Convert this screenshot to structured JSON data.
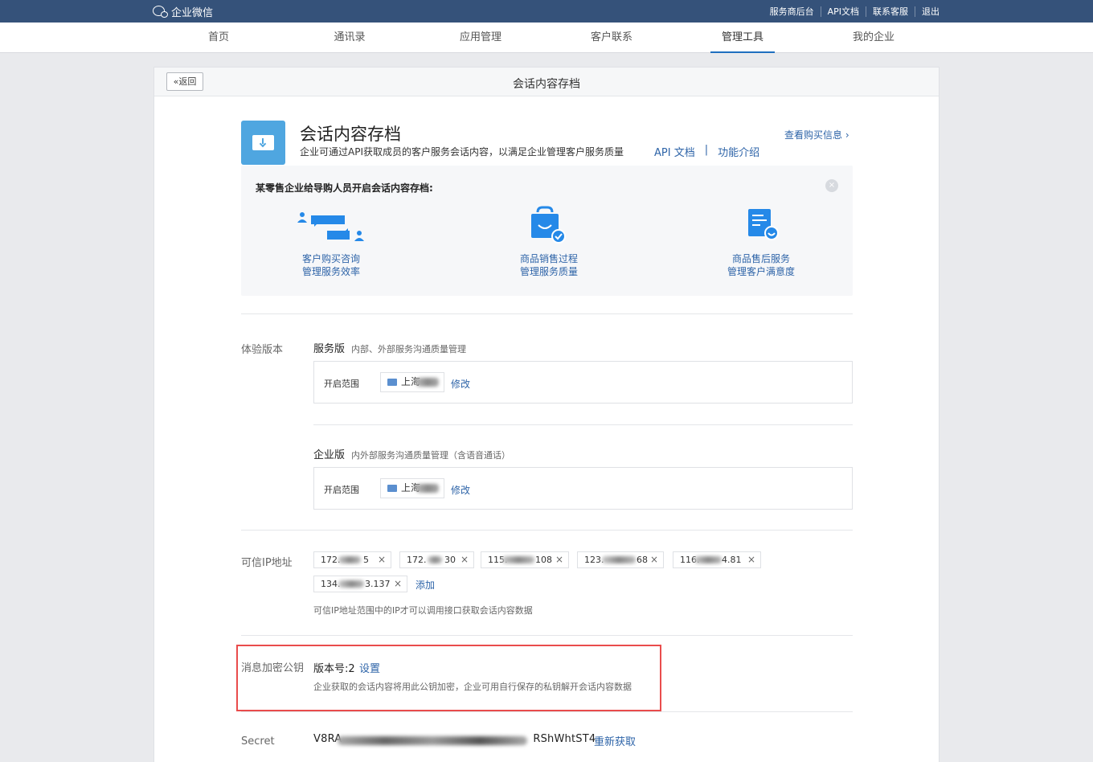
{
  "topbar": {
    "logo_text": "企业微信",
    "links": [
      "服务商后台",
      "API文档",
      "联系客服",
      "退出"
    ]
  },
  "nav": {
    "items": [
      "首页",
      "通讯录",
      "应用管理",
      "客户联系",
      "管理工具",
      "我的企业"
    ],
    "active": "管理工具"
  },
  "panel": {
    "back_label": "返回",
    "title": "会话内容存档"
  },
  "app": {
    "title": "会话内容存档",
    "description": "企业可通过API获取成员的客户服务会话内容，以满足企业管理客户服务质量",
    "links": [
      "API 文档",
      "功能介绍"
    ],
    "link_separator": "|",
    "buy_info": "查看购买信息 ›"
  },
  "promo": {
    "title": "某零售企业给导购人员开启会话内容存档:",
    "close_icon": "×",
    "features": [
      {
        "line1": "客户购买咨询",
        "line2": "管理服务效率",
        "icon": "chat-people-icon"
      },
      {
        "line1": "商品销售过程",
        "line2": "管理服务质量",
        "icon": "shopping-bag-icon"
      },
      {
        "line1": "商品售后服务",
        "line2": "管理客户满意度",
        "icon": "document-smile-icon"
      }
    ]
  },
  "trial": {
    "label": "体验版本",
    "versions": [
      {
        "name": "服务版",
        "desc": "内部、外部服务沟通质量管理",
        "scope_label": "开启范围",
        "scope_value": "上海",
        "edit": "修改"
      },
      {
        "name": "企业版",
        "desc": "内外部服务沟通质量管理（含语音通话）",
        "scope_label": "开启范围",
        "scope_value": "上海",
        "edit": "修改"
      }
    ]
  },
  "ip": {
    "label": "可信IP地址",
    "tags": [
      {
        "head": "172.",
        "tail": "5"
      },
      {
        "head": "172.",
        "tail": "30"
      },
      {
        "head": "115.",
        "tail": "108"
      },
      {
        "head": "123.",
        "tail": "68"
      },
      {
        "head": "116.",
        "tail": "4.81"
      },
      {
        "head": "134.",
        "tail": "3.137"
      }
    ],
    "remove_icon": "×",
    "add": "添加",
    "hint": "可信IP地址范围中的IP才可以调用接口获取会话内容数据"
  },
  "key": {
    "label": "消息加密公钥",
    "version": "版本号:2",
    "set": "设置",
    "hint": "企业获取的会话内容将用此公钥加密，企业可用自行保存的私钥解开会话内容数据"
  },
  "secret": {
    "label": "Secret",
    "head": "V8RA",
    "tail": "RShWhtST4",
    "refetch": "重新获取"
  },
  "colors": {
    "topbar": "#35527a",
    "link": "#2e64a8",
    "highlight": "#e94c4c",
    "feature_icon": "#2589e8"
  }
}
